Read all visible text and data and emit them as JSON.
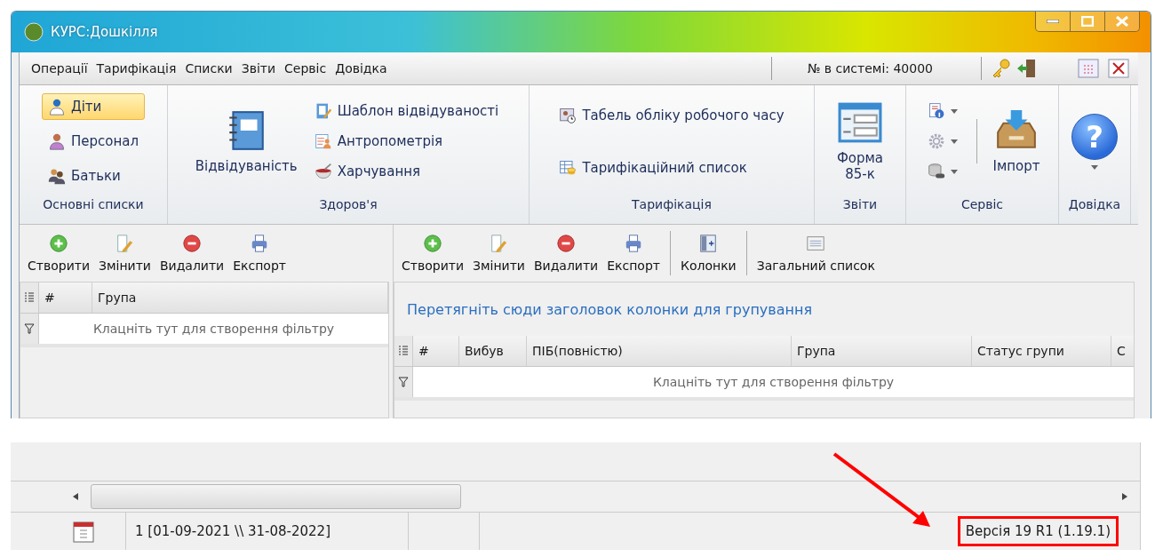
{
  "window": {
    "title": "КУРС:Дошкілля"
  },
  "menu": {
    "items": [
      "Операції",
      "Тарифікація",
      "Списки",
      "Звіти",
      "Сервіс",
      "Довідка"
    ],
    "system_number": "№ в системі: 40000"
  },
  "ribbon": {
    "groups": [
      {
        "label": "Основні списки",
        "kind": "column",
        "items": [
          {
            "kind": "child",
            "label": "Діти",
            "selected": true
          },
          {
            "kind": "staff",
            "label": "Персонал",
            "selected": false
          },
          {
            "kind": "parents",
            "label": "Батьки",
            "selected": false
          }
        ]
      },
      {
        "label": "Здоров'я",
        "kind": "mixed",
        "items": [
          {
            "kind": "notebook",
            "label": "Відвідуваність"
          },
          {
            "kind": "template",
            "label": "Шаблон відвідуваності"
          },
          {
            "kind": "anthropometry",
            "label": "Антропометрія"
          },
          {
            "kind": "food",
            "label": "Харчування"
          }
        ]
      },
      {
        "label": "Тарифікація",
        "kind": "column",
        "items": [
          {
            "kind": "timesheet",
            "label": "Табель обліку робочого часу"
          },
          {
            "kind": "tariff",
            "label": "Тарифікаційний список"
          }
        ]
      },
      {
        "label": "Звіти",
        "kind": "large",
        "items": [
          {
            "kind": "form",
            "label": "Форма 85-к"
          }
        ]
      },
      {
        "label": "Сервіс",
        "kind": "service",
        "items": [
          {
            "kind": "info"
          },
          {
            "kind": "gear"
          },
          {
            "kind": "database"
          },
          {
            "kind": "import",
            "label": "Імпорт"
          }
        ]
      },
      {
        "label": "Довідка",
        "kind": "large",
        "items": [
          {
            "kind": "help",
            "glyph": "?"
          }
        ]
      }
    ]
  },
  "left_panel": {
    "toolbar": [
      {
        "kind": "create",
        "label": "Створити"
      },
      {
        "kind": "edit",
        "label": "Змінити"
      },
      {
        "kind": "delete",
        "label": "Видалити"
      },
      {
        "kind": "export",
        "label": "Експорт"
      }
    ],
    "columns": [
      "#",
      "Група"
    ],
    "filter_hint": "Клацніть тут для створення фільтру"
  },
  "right_panel": {
    "toolbar": [
      {
        "kind": "create",
        "label": "Створити"
      },
      {
        "kind": "edit",
        "label": "Змінити"
      },
      {
        "kind": "delete",
        "label": "Видалити"
      },
      {
        "kind": "export",
        "label": "Експорт"
      },
      {
        "kind": "columns",
        "label": "Колонки"
      },
      {
        "kind": "list",
        "label": "Загальний список"
      }
    ],
    "group_hint": "Перетягніть сюди заголовок колонки для групування",
    "columns": [
      "#",
      "Вибув",
      "ПІБ(повністю)",
      "Група",
      "Статус групи",
      "С"
    ],
    "filter_hint": "Клацніть тут для створення фільтру"
  },
  "status_bar": {
    "period": "1 [01-09-2021 \\\\ 31-08-2022]",
    "version": "Версія  19 R1 (1.19.1)"
  }
}
